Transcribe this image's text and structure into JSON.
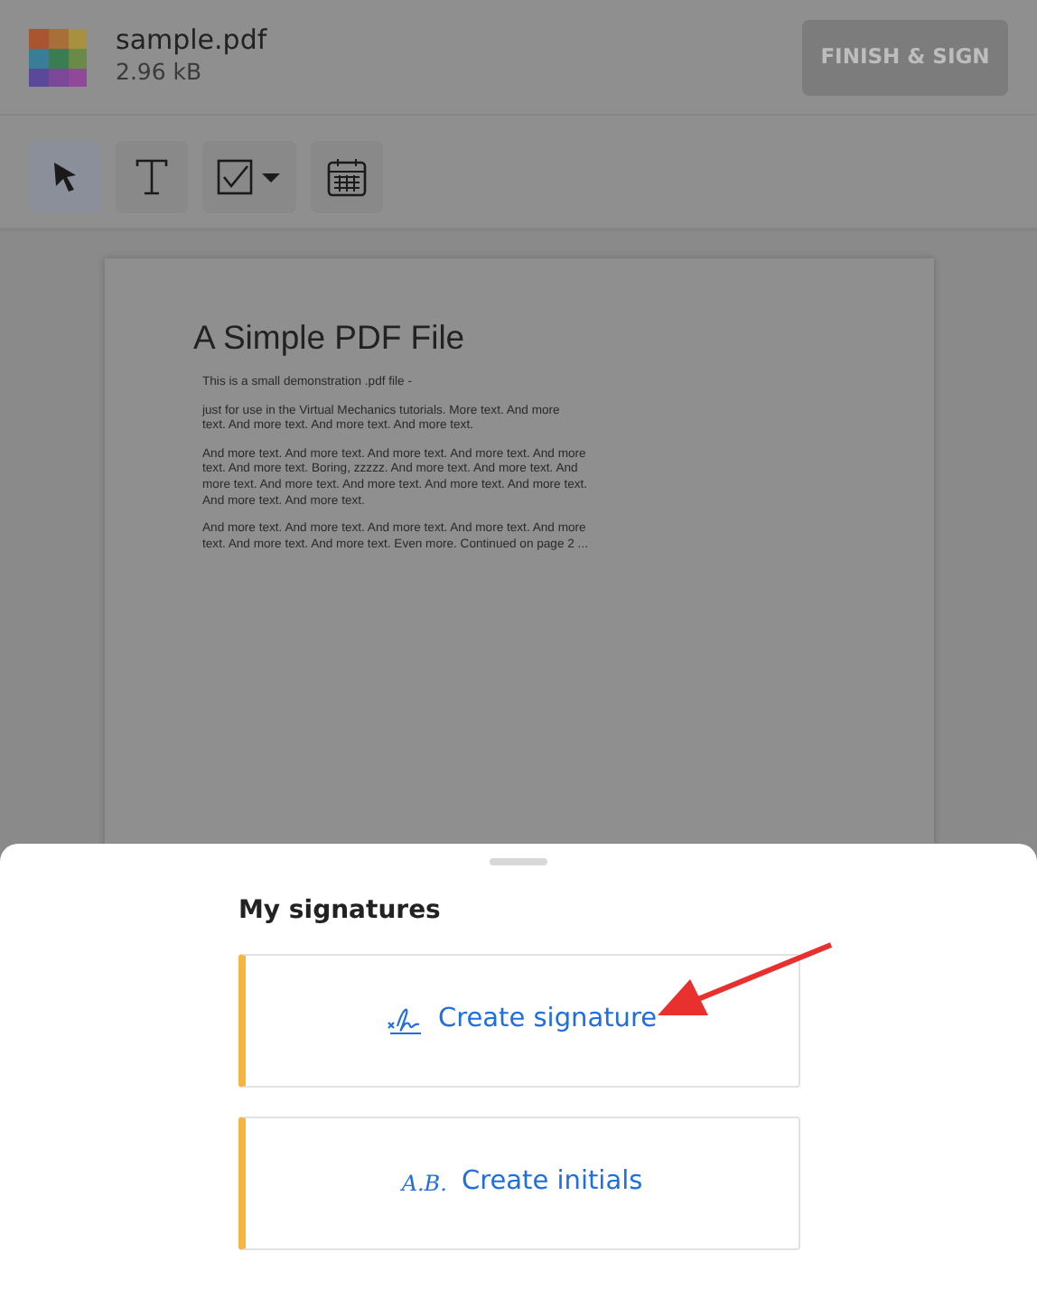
{
  "file": {
    "name": "sample.pdf",
    "size": "2.96 kB"
  },
  "finish_button": {
    "label": "FINISH & SIGN",
    "disabled": true
  },
  "tools": [
    {
      "kind": "pointer",
      "selected": true
    },
    {
      "kind": "text",
      "selected": false
    },
    {
      "kind": "checkbox",
      "selected": false
    },
    {
      "kind": "date",
      "selected": false
    }
  ],
  "document": {
    "title": "A Simple PDF File",
    "paragraphs": [
      [
        "This is a small demonstration .pdf file -"
      ],
      [
        "just for use in the Virtual Mechanics tutorials. More text. And more",
        "text. And more text. And more text. And more text."
      ],
      [
        "And more text. And more text. And more text. And more text. And more",
        "text. And more text. Boring, zzzzz. And more text. And more text. And",
        "more text. And more text. And more text. And more text. And more text.",
        "And more text. And more text."
      ],
      [
        "And more text. And more text. And more text. And more text. And more",
        "text. And more text. And more text. Even more. Continued on page 2 ..."
      ]
    ]
  },
  "sheet": {
    "title": "My signatures",
    "options": [
      {
        "kind": "signature",
        "label": "Create signature"
      },
      {
        "kind": "initials",
        "icon_text": "A.B.",
        "label": "Create initials"
      }
    ]
  }
}
